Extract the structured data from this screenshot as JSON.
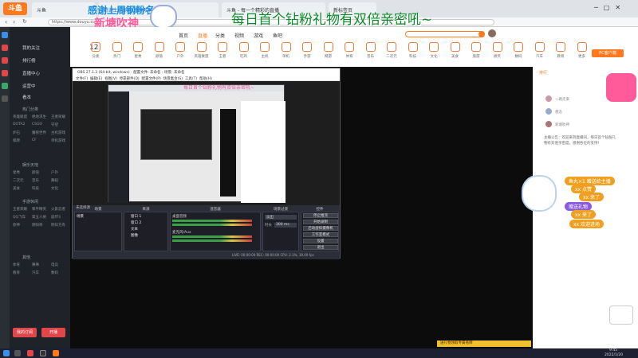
{
  "browser": {
    "tabs": [
      {
        "label": "斗鱼"
      },
      {
        "label": "感谢上周钢粉  新塘吹神"
      },
      {
        "label": "斗鱼 - 每一个精彩的直播"
      },
      {
        "label": "新标签页"
      }
    ],
    "address": "https://www.douyu.com/"
  },
  "overlay": {
    "thanks_banner": "感谢上周钢粉名",
    "streamer_name": "新塘吹神",
    "promo_text": "每日首个钻粉礼物有双倍亲密吼~"
  },
  "site": {
    "logo": "斗鱼",
    "nav": [
      "首页",
      "直播",
      "分类",
      "视频",
      "游戏",
      "鱼吧"
    ],
    "stats_number": "12",
    "categories": [
      "分类",
      "热门",
      "星秀",
      "颜值",
      "户外",
      "英雄联盟",
      "王者",
      "吃鸡",
      "主机",
      "单机",
      "手游",
      "网游",
      "体育",
      "音乐",
      "二次元",
      "科技",
      "文化",
      "美食",
      "旅游",
      "搞笑",
      "数码",
      "汽车",
      "教育",
      "更多"
    ],
    "pc_client": "PC客户端"
  },
  "sidebar": {
    "items": [
      "我的关注",
      "排行榜",
      "直播中心",
      "运营中",
      "看本"
    ],
    "sections": [
      {
        "title": "热门分类",
        "rows": [
          [
            "英雄联盟",
            "绝地求生",
            "王者荣耀"
          ],
          [
            "DOTA2",
            "CSGO",
            "守望"
          ],
          [
            "炉石",
            "魔兽世界",
            "主机游戏"
          ],
          [
            "棋牌",
            "CF",
            "单机游戏"
          ]
        ]
      },
      {
        "title": "娱乐天地",
        "rows": [
          [
            "星秀",
            "颜值",
            "户外"
          ],
          [
            "二次元",
            "音乐",
            "舞蹈"
          ],
          [
            "美食",
            "科技",
            "文化"
          ]
        ]
      },
      {
        "title": "手游休闲",
        "rows": [
          [
            "王者荣耀",
            "和平精英",
            "火影忍者"
          ],
          [
            "QQ飞车",
            "第五人格",
            "崩坏3"
          ],
          [
            "原神",
            "阴阳师",
            "明日方舟"
          ]
        ]
      },
      {
        "title": "其他",
        "rows": [
          [
            "体育",
            "赛事",
            "电竞"
          ],
          [
            "教育",
            "汽车",
            "数码"
          ]
        ]
      }
    ],
    "buttons": [
      "我的订阅",
      "开播"
    ]
  },
  "obs": {
    "title": "OBS 27.1.3 (64-bit, windows) - 配置文件: 未命名 - 场景: 未命名",
    "menu": [
      "文件(F)",
      "编辑(E)",
      "视图(V)",
      "停靠部件(D)",
      "配置文件(P)",
      "场景集合(S)",
      "工具(T)",
      "帮助(H)"
    ],
    "no_source": "未选择源",
    "scene_panel": "场景",
    "scene_name": "场景",
    "source_panel": "来源",
    "sources": [
      "窗口 1",
      "窗口 2",
      "文本",
      "图像"
    ],
    "mixer_panel": "混音器",
    "mixer_tracks": [
      "桌面音频",
      "麦克风/Aux"
    ],
    "transition_panel": "场景过渡",
    "transition_value": "淡出",
    "duration_label": "时长",
    "duration_value": "300 ms",
    "controls_panel": "控件",
    "controls": [
      "停止推流",
      "开始录制",
      "启动虚拟摄像机",
      "工作室模式",
      "设置",
      "退出"
    ],
    "status": "LIVE: 00:00:00  REC: 00:00:00  CPU: 2.1%, 30.00 fps"
  },
  "chat": {
    "top_rank": "排行",
    "users": [
      "一路走来",
      "想念",
      "新塘吹神"
    ],
    "notice": "主播公告：欢迎来到直播间，每日首个钻粉礼物有双倍亲密度，感谢各位的支持！",
    "gifts": [
      "鱼丸×1 赠送给主播",
      "xx 点赞",
      "xx 来了",
      "赠送礼物",
      "xx 来了",
      "xx 欢迎进场"
    ],
    "bottom_bar": "送礼物领取专属铭牌"
  },
  "taskbar": {
    "time": "9:45",
    "date": "2022/1/20"
  },
  "colors": {
    "douyu_orange": "#ff7a1e",
    "overlay_green": "#0a8a2a",
    "overlay_pink": "#e85a9a"
  }
}
